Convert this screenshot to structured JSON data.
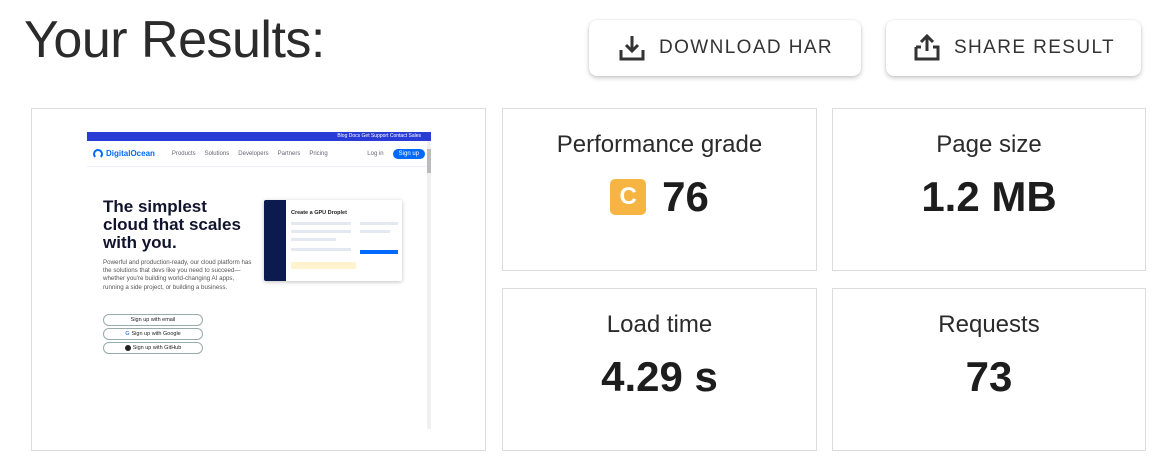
{
  "heading": "Your Results:",
  "actions": {
    "download_label": "DOWNLOAD HAR",
    "share_label": "SHARE RESULT"
  },
  "metrics": {
    "performance": {
      "label": "Performance grade",
      "grade": "C",
      "score": "76",
      "grade_color": "#f6b443"
    },
    "page_size": {
      "label": "Page size",
      "value": "1.2 MB"
    },
    "load_time": {
      "label": "Load time",
      "value": "4.29 s"
    },
    "requests": {
      "label": "Requests",
      "value": "73"
    }
  },
  "screenshot": {
    "topbar_text": "Blog Docs Get Support Contact Sales",
    "brand": "DigitalOcean",
    "nav": [
      "Products",
      "Solutions",
      "Developers",
      "Partners",
      "Pricing"
    ],
    "login": "Log in",
    "signup": "Sign up",
    "headline": "The simplest cloud that scales with you.",
    "paragraph": "Powerful and production-ready, our cloud platform has the solutions that devs like you need to succeed—whether you're building world-changing AI apps, running a side project, or building a business.",
    "buttons": [
      "Sign up with email",
      "Sign up with Google",
      "Sign up with GitHub"
    ],
    "panel_title": "Create a GPU Droplet",
    "accent": "#0069ff",
    "topbar_color": "#2a3cd6"
  }
}
